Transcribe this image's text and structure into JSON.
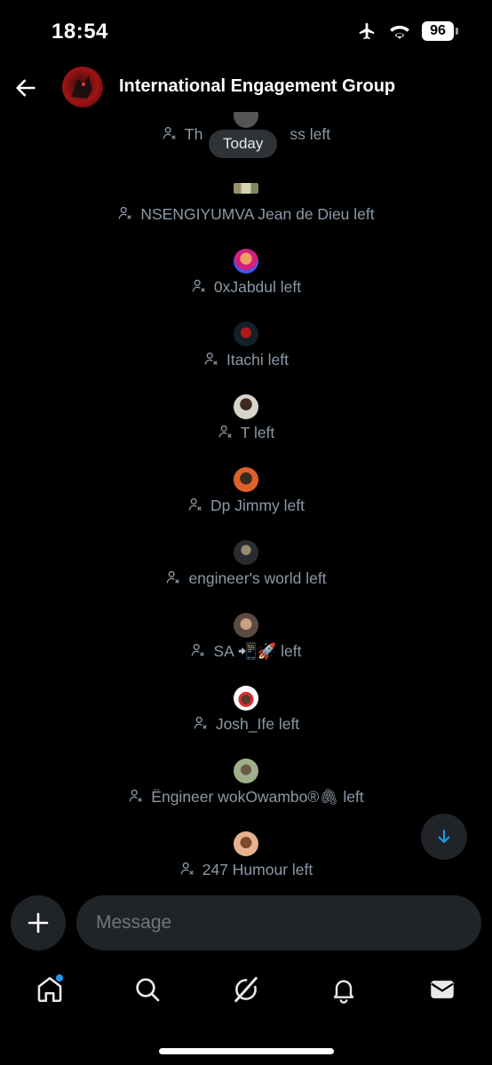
{
  "status_bar": {
    "time": "18:54",
    "battery": "96"
  },
  "header": {
    "title": "International Engagement Group"
  },
  "date_pill": "Today",
  "events": [
    {
      "text_before": "Th",
      "text_after": "ss left",
      "avatar": "partial"
    },
    {
      "text": "NSENGIYUMVA Jean de Dieu left",
      "avatar": "flag"
    },
    {
      "text": "0xJabdul left",
      "avatar": "blue"
    },
    {
      "text": "Itachi left",
      "avatar": "red"
    },
    {
      "text": "T left",
      "avatar": "grey"
    },
    {
      "text": "Dp Jimmy left",
      "avatar": "orange"
    },
    {
      "text": "engineer's world left",
      "avatar": "dark"
    },
    {
      "text": "SA 📲🚀 left",
      "avatar": "brown"
    },
    {
      "text": "Josh_Ife left",
      "avatar": "white-red"
    },
    {
      "text": "Ëngineer wokOwambo®🖇 left",
      "avatar": "green"
    },
    {
      "text": "247 Humour left",
      "avatar": "peach"
    }
  ],
  "composer": {
    "placeholder": "Message"
  },
  "nav": {
    "items": [
      "home-icon",
      "search-icon",
      "grok-icon",
      "notifications-icon",
      "messages-icon"
    ]
  },
  "colors": {
    "accent": "#1d9bf0",
    "muted_text": "#8b98a5",
    "surface": "#202327"
  }
}
